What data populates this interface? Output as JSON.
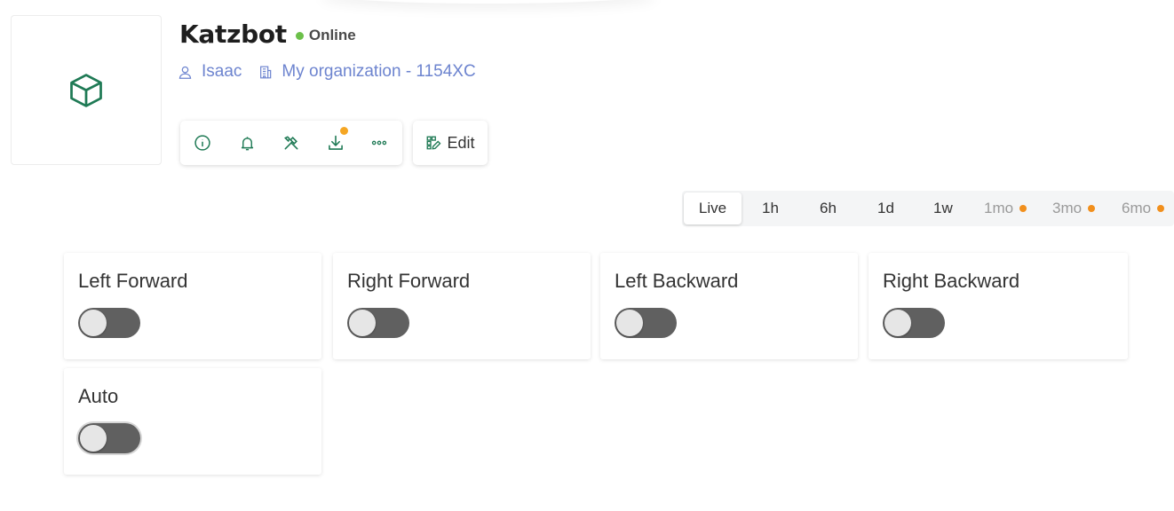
{
  "device": {
    "name": "Katzbot",
    "status": "Online",
    "owner": "Isaac",
    "organization": "My organization - 1154XC"
  },
  "toolbar": {
    "buttons": [
      "info-icon",
      "bell-icon",
      "tools-icon",
      "download-icon",
      "more-icon"
    ],
    "edit_label": "Edit"
  },
  "time_range": {
    "options": [
      "Live",
      "1h",
      "6h",
      "1d",
      "1w",
      "1mo",
      "3mo",
      "6mo"
    ],
    "selected": "Live"
  },
  "controls": [
    {
      "label": "Left Forward",
      "on": false
    },
    {
      "label": "Right Forward",
      "on": false
    },
    {
      "label": "Left Backward",
      "on": false
    },
    {
      "label": "Right Backward",
      "on": false
    },
    {
      "label": "Auto",
      "on": false
    }
  ],
  "colors": {
    "accent_green": "#1f7a55",
    "link_blue": "#6d84cf",
    "status_green": "#6cc04a",
    "notification_orange": "#f5a623"
  }
}
